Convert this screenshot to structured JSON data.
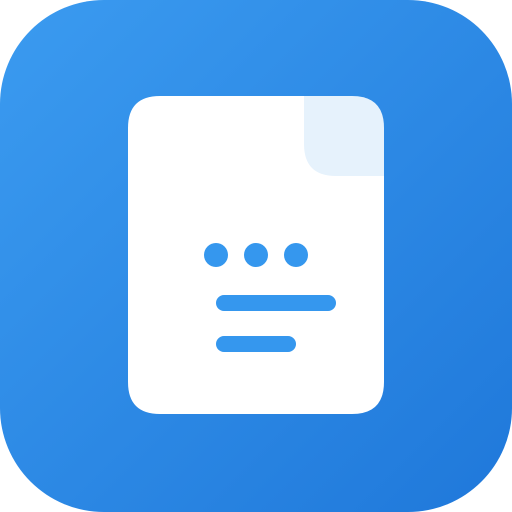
{
  "icon": {
    "name": "document-icon",
    "colors": {
      "background_start": "#3B9BF0",
      "background_end": "#1F78DA",
      "page": "#FFFFFF",
      "page_fold": "#E6F2FC",
      "accent": "#3597EE"
    }
  }
}
